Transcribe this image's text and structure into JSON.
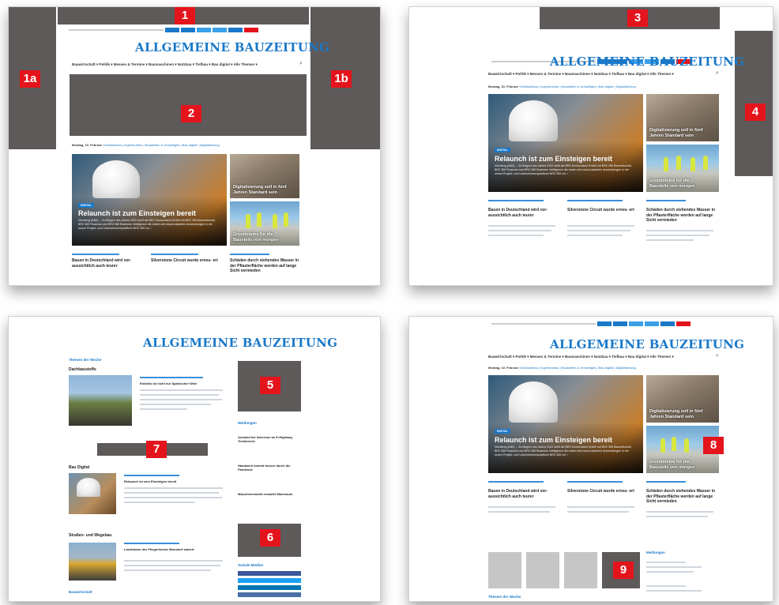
{
  "site": {
    "logo": "ALLGEMEINE BAUZEITUNG"
  },
  "menu": "Bauwirtschaft ▾   Politik ▾   Messen & Termine ▾   Baumaschinen ▾   Nutzbau ▾   Tiefbau ▾   Bau digital ▾   Alle Themen ▾",
  "crumbs": {
    "date": "Montag, 10. Februar",
    "rest": "Schlüsselbau  |  Ingenieurbau  |  Baustellen & Jenseitiges  |  Bau digital  |  Digitalisierung"
  },
  "hero": {
    "tag": "DIGITAL",
    "title": "Relaunch ist zum Einsteigen bereit",
    "text": "Nürnberg (ABZ). – Zu Beginn des Jahres 2022 stellt die BRZ Deutschland GmbH mit BRZ 365 Bauwirtschaft, BRZ 365 Finanzen und BRZ 365 Business Intelligence die ersten drei cloud-basierten Anwendungen in der neuen Projekt- und Unternehmensplattform BRZ 365 vor. ›"
  },
  "side": {
    "card1": "Digitalisierung soll in fünf Jahren Standard sein",
    "card2": "Grundsteine für die Baustelle von morgen"
  },
  "articles": [
    {
      "title": "Bauen in Deutschland wird vor- aussichtlich auch teurer"
    },
    {
      "title": "Silverstone Circuit wurde erneu- ert"
    },
    {
      "title": "Schäden durch stehendes Wasser in der Pflasterfläche werden auf lange Sicht vermieden"
    }
  ],
  "badges": {
    "b1": "1",
    "b1a": "1a",
    "b1b": "1b",
    "b2": "2",
    "b3": "3",
    "b4": "4",
    "b5": "5",
    "b6": "6",
    "b7": "7",
    "b8": "8",
    "b9": "9"
  },
  "panel3": {
    "section1": "Themen der Woche",
    "head1": "Dachbaustoffe",
    "article1": "Einblick ist nicht nur Spanischer Weie",
    "head2": "Bau Digital",
    "article2": "Relaunch ist zum Einsteigen bereit",
    "head3": "Straßen- und Wegebau",
    "article3": "Landebahn des Fliegerhorsts Wunstorf saniert",
    "section2": "Bauwirtschaft",
    "sidebar": "Meldungen",
    "news": [
      "Ausland bei Interesse an E-Highway-Teststrecke",
      "Handwerk kommt besser durch die Pandemie",
      "Maschinenmarkt erwartet Wachstum"
    ],
    "social": "Soziale Medien"
  },
  "panel4": {
    "section": "Themen der Woche",
    "sidebar": "Meldungen"
  },
  "colors": {
    "brand_blue": "#1a78c8",
    "badge_red": "#e4141c",
    "placeholder_gray": "#5d5a59"
  }
}
